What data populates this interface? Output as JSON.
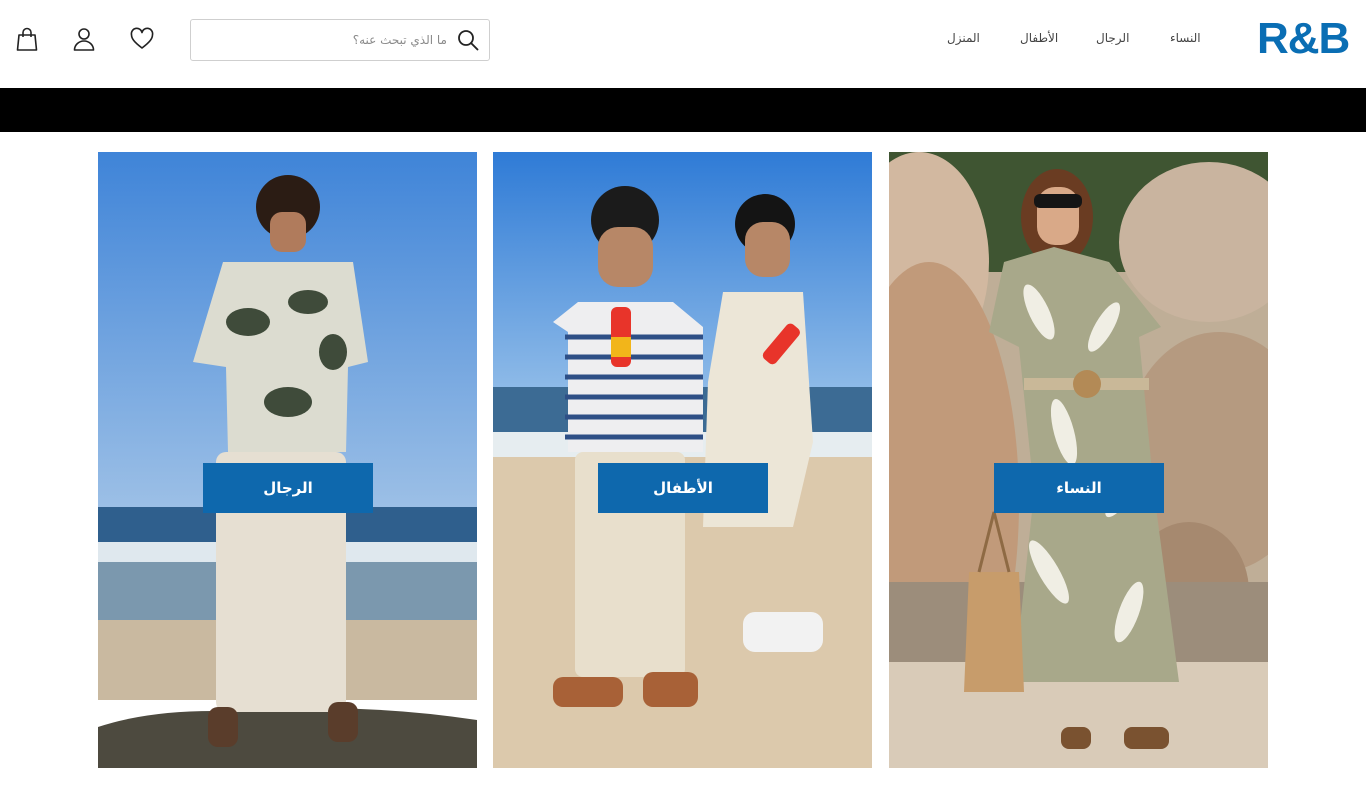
{
  "header": {
    "logo_text": "R&B",
    "search": {
      "placeholder": "ما الذي تبحث عنه؟"
    },
    "nav": [
      "النساء",
      "الرجال",
      "الأطفال",
      "المنزل"
    ],
    "icons": {
      "cart": "shopping-bag-icon",
      "account": "user-icon",
      "wishlist": "heart-icon",
      "search": "search-icon"
    }
  },
  "categories": [
    {
      "label": "الرجال"
    },
    {
      "label": "الأطفال"
    },
    {
      "label": "النساء"
    }
  ],
  "colors": {
    "brand": "#0a6eb4",
    "cta": "#0e68ad",
    "banner": "#000000"
  }
}
